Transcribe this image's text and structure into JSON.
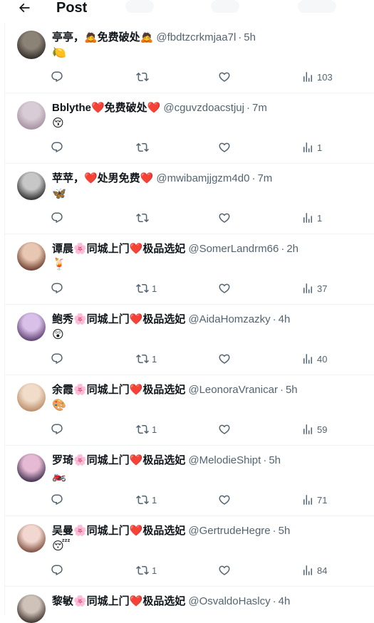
{
  "header": {
    "title": "Post"
  },
  "posts": [
    {
      "name": "亭亭，🙇免费破处🙇",
      "handle": "@fbdtzcrkmjaa7l",
      "time": "5h",
      "body": "🍋",
      "replies": "",
      "reposts": "",
      "likes": "",
      "views": "103",
      "avatar_colors": [
        "#8c8377",
        "#2f2a25"
      ]
    },
    {
      "name": "Bblythe❤️免费破处❤️",
      "handle": "@cguvzdoacstjuj",
      "time": "7m",
      "body": "😚",
      "replies": "",
      "reposts": "",
      "likes": "",
      "views": "1",
      "avatar_colors": [
        "#d8cdd6",
        "#a58ea0"
      ]
    },
    {
      "name": "苹苹，❤️处男免费❤️",
      "handle": "@mwibamjjgzm4d0",
      "time": "7m",
      "body": "🦋",
      "replies": "",
      "reposts": "",
      "likes": "",
      "views": "1",
      "avatar_colors": [
        "#c7c7c7",
        "#2a2a2a"
      ]
    },
    {
      "name": "谭晨🌸同城上门❤️极品选妃",
      "handle": "@SomerLandrm66",
      "time": "2h",
      "body": "🍹",
      "replies": "",
      "reposts": "1",
      "likes": "",
      "views": "37",
      "avatar_colors": [
        "#e8c7b2",
        "#6a3a2c"
      ]
    },
    {
      "name": "鲍秀🌸同城上门❤️极品选妃",
      "handle": "@AidaHomzazky",
      "time": "4h",
      "body": "😲",
      "replies": "",
      "reposts": "1",
      "likes": "",
      "views": "40",
      "avatar_colors": [
        "#d9c0e8",
        "#5a3c6e"
      ]
    },
    {
      "name": "余霞🌸同城上门❤️极品选妃",
      "handle": "@LeonoraVranicar",
      "time": "5h",
      "body": "🎨",
      "replies": "",
      "reposts": "1",
      "likes": "",
      "views": "59",
      "avatar_colors": [
        "#f0dcc8",
        "#b98a66"
      ]
    },
    {
      "name": "罗琦🌸同城上门❤️极品选妃",
      "handle": "@MelodieShipt",
      "time": "5h",
      "body": "🏍️",
      "replies": "",
      "reposts": "1",
      "likes": "",
      "views": "71",
      "avatar_colors": [
        "#e6b9d4",
        "#3a2c4a"
      ]
    },
    {
      "name": "吴曼🌸同城上门❤️极品选妃",
      "handle": "@GertrudeHegre",
      "time": "5h",
      "body": "😴",
      "replies": "",
      "reposts": "1",
      "likes": "",
      "views": "84",
      "avatar_colors": [
        "#f1d7cf",
        "#7c4a3a"
      ]
    },
    {
      "name": "黎敏🌸同城上门❤️极品选妃",
      "handle": "@OsvaldoHaslcy",
      "time": "4h",
      "body": "",
      "replies": "",
      "reposts": "",
      "likes": "",
      "views": "",
      "avatar_colors": [
        "#cfc2b8",
        "#3b2e29"
      ]
    }
  ],
  "colors": {
    "text": "#0f1419",
    "secondary": "#536471",
    "border": "#eff3f4"
  },
  "icons": {
    "back": "arrow-left-icon",
    "reply": "reply-icon",
    "repost": "repost-icon",
    "like": "heart-icon",
    "views": "views-icon"
  }
}
